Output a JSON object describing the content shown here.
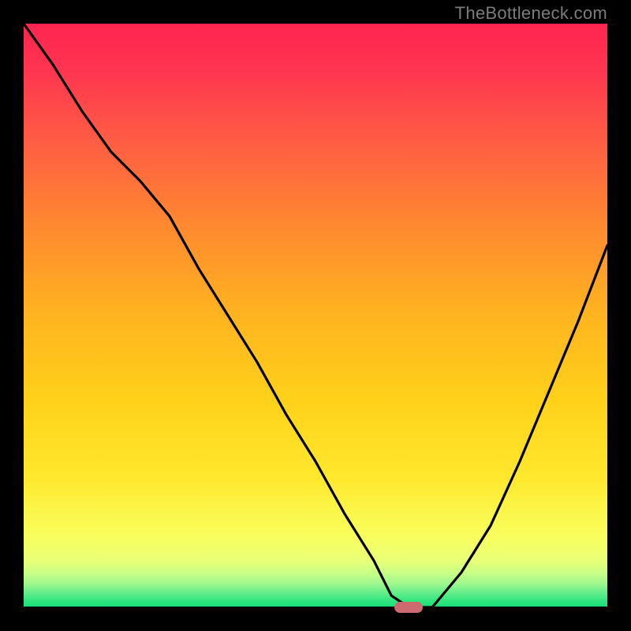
{
  "watermark": "TheBottleneck.com",
  "chart_data": {
    "type": "line",
    "title": "",
    "xlabel": "",
    "ylabel": "",
    "xlim": [
      0,
      100
    ],
    "ylim": [
      0,
      100
    ],
    "grid": false,
    "legend": false,
    "series": [
      {
        "name": "bottleneck-curve",
        "x": [
          0,
          5,
          10,
          15,
          20,
          25,
          30,
          35,
          40,
          45,
          50,
          55,
          60,
          63,
          66,
          70,
          75,
          80,
          85,
          90,
          95,
          100
        ],
        "values": [
          100,
          93,
          85,
          78,
          73,
          67,
          58,
          50,
          42,
          33,
          25,
          16,
          8,
          2,
          0,
          0,
          6,
          14,
          25,
          37,
          49,
          62
        ]
      }
    ],
    "marker": {
      "x": 66,
      "y": 0,
      "color": "#cc6a70"
    },
    "background_gradient_top": "#ff2c55",
    "background_gradient_mid": "#ffd400",
    "background_gradient_low": "#f6ff7a",
    "background_gradient_bottom": "#17e276"
  }
}
